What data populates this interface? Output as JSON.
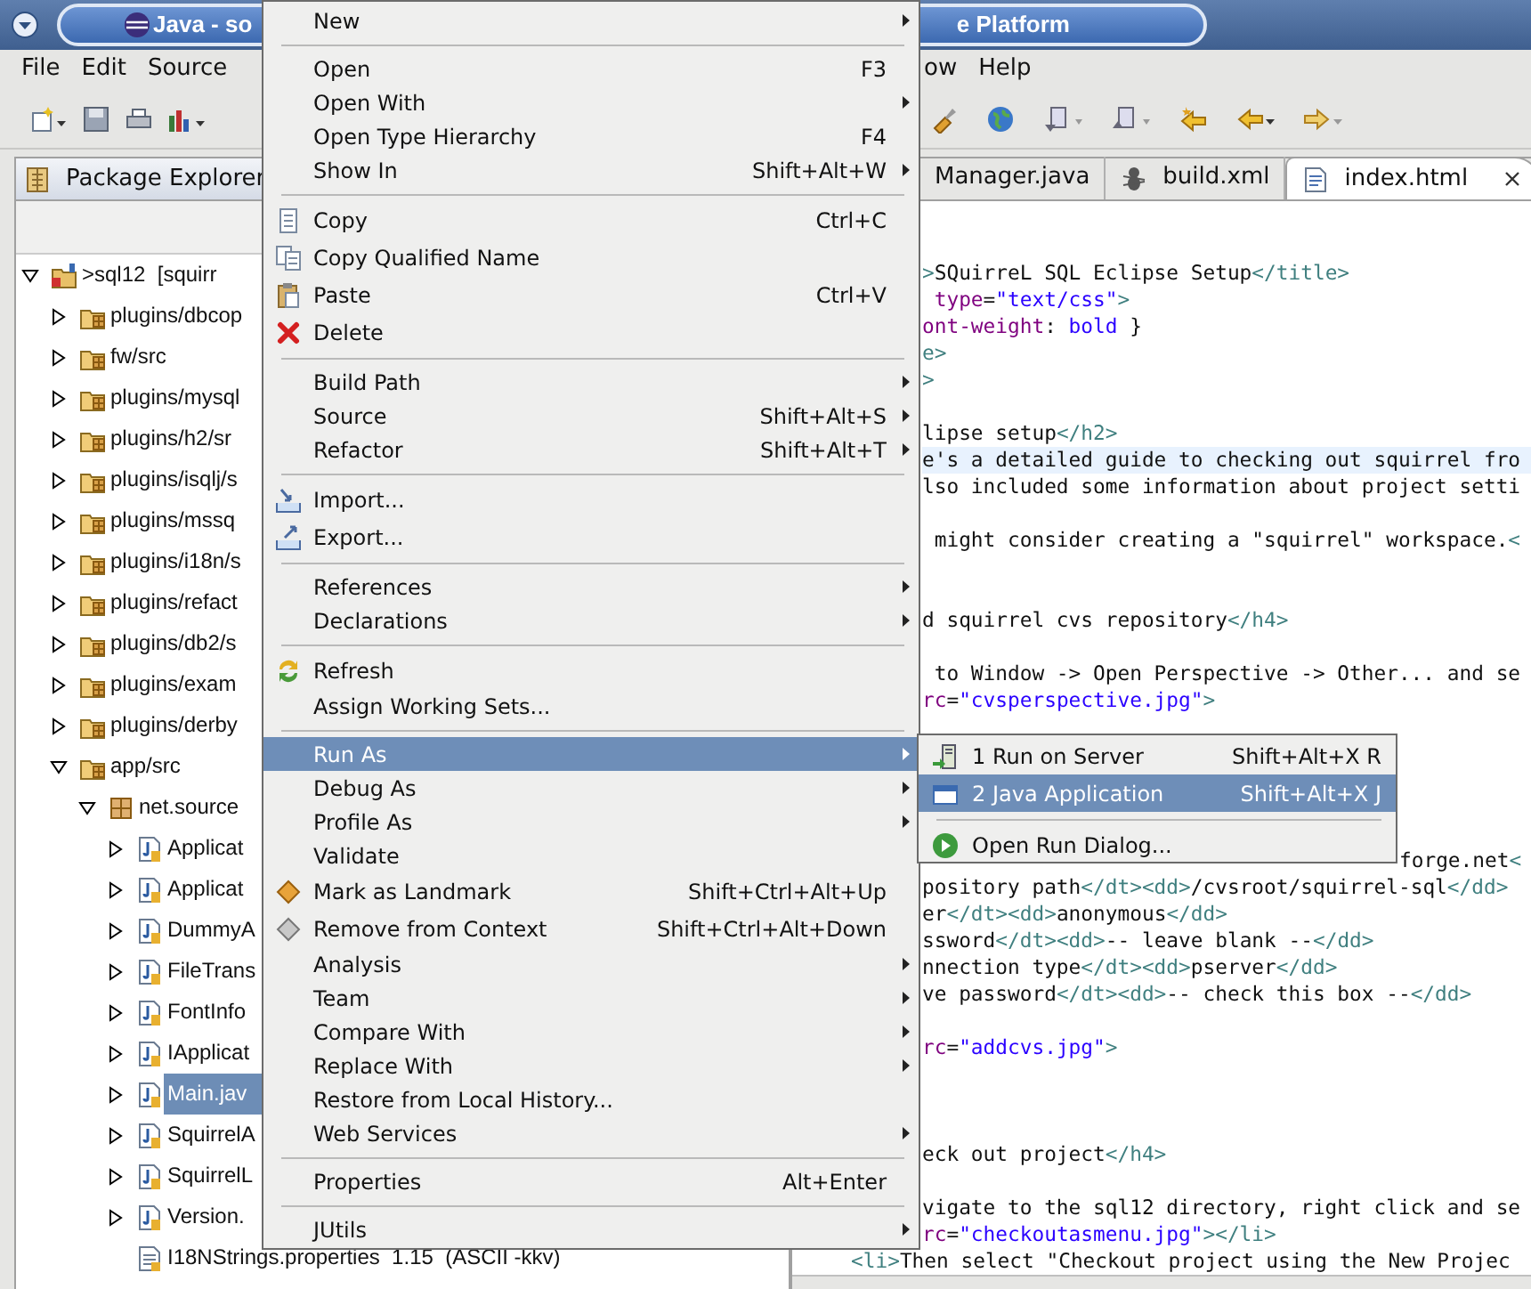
{
  "window": {
    "title_left": "Java - so",
    "title_right": "e Platform"
  },
  "menubar": [
    {
      "label": "File",
      "kind": "left"
    },
    {
      "label": "Edit",
      "kind": "left"
    },
    {
      "label": "Source",
      "kind": "left"
    },
    {
      "label": "ow",
      "kind": "right"
    },
    {
      "label": "Help",
      "kind": "right"
    }
  ],
  "package_explorer": {
    "tab_label": "Package Explorer",
    "items": [
      {
        "label": ">sql12  [squirr",
        "kind": "project",
        "expanded": true,
        "selected": false,
        "children": [
          {
            "label": "plugins/dbcop",
            "kind": "folder",
            "expanded": false,
            "selected": false
          },
          {
            "label": "fw/src",
            "kind": "folder",
            "expanded": false,
            "selected": false
          },
          {
            "label": "plugins/mysql",
            "kind": "folder",
            "expanded": false,
            "selected": false
          },
          {
            "label": "plugins/h2/sr",
            "kind": "folder",
            "expanded": false,
            "selected": false
          },
          {
            "label": "plugins/isqlj/s",
            "kind": "folder",
            "expanded": false,
            "selected": false
          },
          {
            "label": "plugins/mssq",
            "kind": "folder",
            "expanded": false,
            "selected": false
          },
          {
            "label": "plugins/i18n/s",
            "kind": "folder",
            "expanded": false,
            "selected": false
          },
          {
            "label": "plugins/refact",
            "kind": "folder",
            "expanded": false,
            "selected": false
          },
          {
            "label": "plugins/db2/s",
            "kind": "folder",
            "expanded": false,
            "selected": false
          },
          {
            "label": "plugins/exam",
            "kind": "folder",
            "expanded": false,
            "selected": false
          },
          {
            "label": "plugins/derby",
            "kind": "folder",
            "expanded": false,
            "selected": false
          },
          {
            "label": "app/src",
            "kind": "folder",
            "expanded": true,
            "selected": false,
            "children": [
              {
                "label": "net.source",
                "kind": "package",
                "expanded": true,
                "selected": false,
                "children": [
                  {
                    "label": "Applicat",
                    "kind": "java",
                    "expanded": false,
                    "selected": false
                  },
                  {
                    "label": "Applicat",
                    "kind": "java",
                    "expanded": false,
                    "selected": false
                  },
                  {
                    "label": "DummyA",
                    "kind": "java",
                    "expanded": false,
                    "selected": false
                  },
                  {
                    "label": "FileTrans",
                    "kind": "java",
                    "expanded": false,
                    "selected": false
                  },
                  {
                    "label": "FontInfo",
                    "kind": "java",
                    "expanded": false,
                    "selected": false
                  },
                  {
                    "label": "IApplicat",
                    "kind": "java",
                    "expanded": false,
                    "selected": false
                  },
                  {
                    "label": "Main.jav",
                    "kind": "java",
                    "expanded": false,
                    "selected": true
                  },
                  {
                    "label": "SquirrelA",
                    "kind": "java",
                    "expanded": false,
                    "selected": false
                  },
                  {
                    "label": "SquirrelL",
                    "kind": "java",
                    "expanded": false,
                    "selected": false
                  },
                  {
                    "label": "Version.",
                    "kind": "java",
                    "expanded": false,
                    "selected": false
                  },
                  {
                    "label": "I18NStrings.properties  1.15  (ASCII -kkv)",
                    "kind": "file",
                    "selected": false
                  }
                ]
              }
            ]
          }
        ]
      }
    ]
  },
  "editor": {
    "tabs": [
      {
        "label": "Manager.java",
        "kind": "partial",
        "selected": false,
        "closable": false
      },
      {
        "label": "build.xml",
        "kind": "ant",
        "selected": false,
        "closable": false
      },
      {
        "label": "index.html",
        "kind": "html",
        "selected": true,
        "closable": true
      }
    ],
    "lines": [
      {
        "kind": "cut",
        "current": false,
        "segments": [
          {
            "t": ">",
            "kind": "tag"
          },
          {
            "t": "SQuirreL SQL Eclipse Setup",
            "kind": "text"
          },
          {
            "t": "</title>",
            "kind": "tag"
          }
        ]
      },
      {
        "kind": "cut",
        "current": false,
        "segments": [
          {
            "t": " type",
            "kind": "attr"
          },
          {
            "t": "=",
            "kind": "text"
          },
          {
            "t": "\"text/css\"",
            "kind": "value"
          },
          {
            "t": ">",
            "kind": "tag"
          }
        ]
      },
      {
        "kind": "cut",
        "current": false,
        "segments": [
          {
            "t": "ont-weight",
            "kind": "attr"
          },
          {
            "t": ": ",
            "kind": "text"
          },
          {
            "t": "bold",
            "kind": "value"
          },
          {
            "t": " }",
            "kind": "text"
          }
        ]
      },
      {
        "kind": "cut",
        "current": false,
        "segments": [
          {
            "t": "e>",
            "kind": "tag"
          }
        ]
      },
      {
        "kind": "cut",
        "current": false,
        "segments": [
          {
            "t": ">",
            "kind": "tag"
          }
        ]
      },
      {
        "kind": "blank"
      },
      {
        "kind": "cut",
        "current": false,
        "segments": [
          {
            "t": "lipse setup",
            "kind": "text"
          },
          {
            "t": "</h2>",
            "kind": "tag"
          }
        ]
      },
      {
        "kind": "cut",
        "current": true,
        "segments": [
          {
            "t": "e's a detailed guide to checking out squirrel fro",
            "kind": "text"
          }
        ]
      },
      {
        "kind": "cut",
        "current": false,
        "segments": [
          {
            "t": "lso included some information about project setti",
            "kind": "text"
          }
        ]
      },
      {
        "kind": "blank"
      },
      {
        "kind": "cut",
        "current": false,
        "segments": [
          {
            "t": " might consider creating a \"squirrel\" workspace.",
            "kind": "text"
          },
          {
            "t": "<",
            "kind": "tag"
          }
        ]
      },
      {
        "kind": "blank"
      },
      {
        "kind": "blank"
      },
      {
        "kind": "cut",
        "current": false,
        "segments": [
          {
            "t": "d squirrel cvs repository",
            "kind": "text"
          },
          {
            "t": "</h4>",
            "kind": "tag"
          }
        ]
      },
      {
        "kind": "blank"
      },
      {
        "kind": "cut",
        "current": false,
        "segments": [
          {
            "t": " to Window -> Open Perspective -> Other... and se",
            "kind": "text"
          }
        ]
      },
      {
        "kind": "cut",
        "current": false,
        "segments": [
          {
            "t": "rc",
            "kind": "attr"
          },
          {
            "t": "=",
            "kind": "text"
          },
          {
            "t": "\"cvsperspective.jpg\"",
            "kind": "value"
          },
          {
            "t": ">",
            "kind": "tag"
          }
        ]
      },
      {
        "kind": "blank"
      },
      {
        "kind": "blank"
      },
      {
        "kind": "blank"
      },
      {
        "kind": "blank"
      },
      {
        "kind": "blank"
      },
      {
        "kind": "behind-submenu",
        "current": false,
        "segments": [
          {
            "t": "forge.net",
            "kind": "text"
          },
          {
            "t": "<",
            "kind": "tag"
          }
        ]
      },
      {
        "kind": "cut",
        "current": false,
        "segments": [
          {
            "t": "pository path",
            "kind": "text"
          },
          {
            "t": "</dt><dd>",
            "kind": "tag"
          },
          {
            "t": "/cvsroot/squirrel-sql",
            "kind": "text"
          },
          {
            "t": "</dd>",
            "kind": "tag"
          }
        ]
      },
      {
        "kind": "cut",
        "current": false,
        "segments": [
          {
            "t": "er",
            "kind": "text"
          },
          {
            "t": "</dt><dd>",
            "kind": "tag"
          },
          {
            "t": "anonymous",
            "kind": "text"
          },
          {
            "t": "</dd>",
            "kind": "tag"
          }
        ]
      },
      {
        "kind": "cut",
        "current": false,
        "segments": [
          {
            "t": "ssword",
            "kind": "text"
          },
          {
            "t": "</dt><dd>",
            "kind": "tag"
          },
          {
            "t": "-- leave blank --",
            "kind": "text"
          },
          {
            "t": "</dd>",
            "kind": "tag"
          }
        ]
      },
      {
        "kind": "cut",
        "current": false,
        "segments": [
          {
            "t": "nnection type",
            "kind": "text"
          },
          {
            "t": "</dt><dd>",
            "kind": "tag"
          },
          {
            "t": "pserver",
            "kind": "text"
          },
          {
            "t": "</dd>",
            "kind": "tag"
          }
        ]
      },
      {
        "kind": "cut",
        "current": false,
        "segments": [
          {
            "t": "ve password",
            "kind": "text"
          },
          {
            "t": "</dt><dd>",
            "kind": "tag"
          },
          {
            "t": "-- check this box --",
            "kind": "text"
          },
          {
            "t": "</dd>",
            "kind": "tag"
          }
        ]
      },
      {
        "kind": "blank"
      },
      {
        "kind": "cut",
        "current": false,
        "segments": [
          {
            "t": "rc",
            "kind": "attr"
          },
          {
            "t": "=",
            "kind": "text"
          },
          {
            "t": "\"addcvs.jpg\"",
            "kind": "value"
          },
          {
            "t": ">",
            "kind": "tag"
          }
        ]
      },
      {
        "kind": "blank"
      },
      {
        "kind": "blank"
      },
      {
        "kind": "blank"
      },
      {
        "kind": "cut",
        "current": false,
        "segments": [
          {
            "t": "eck out project",
            "kind": "text"
          },
          {
            "t": "</h4>",
            "kind": "tag"
          }
        ]
      },
      {
        "kind": "blank"
      },
      {
        "kind": "cut",
        "current": false,
        "segments": [
          {
            "t": "vigate to the sql12 directory, right click and se",
            "kind": "text"
          }
        ]
      },
      {
        "kind": "cut",
        "current": false,
        "segments": [
          {
            "t": "rc",
            "kind": "attr"
          },
          {
            "t": "=",
            "kind": "text"
          },
          {
            "t": "\"checkoutasmenu.jpg\"",
            "kind": "value"
          },
          {
            "t": "></li>",
            "kind": "tag"
          }
        ]
      },
      {
        "kind": "full",
        "current": false,
        "segments": [
          {
            "t": "<li>",
            "kind": "tag"
          },
          {
            "t": "Then select \"Checkout project using the New Projec",
            "kind": "text"
          }
        ]
      }
    ]
  },
  "context_menu": {
    "items": [
      {
        "kind": "item",
        "label": "New",
        "submenu": true,
        "selected": false
      },
      {
        "kind": "separator"
      },
      {
        "kind": "item",
        "label": "Open",
        "shortcut": "F3",
        "submenu": false,
        "selected": false
      },
      {
        "kind": "item",
        "label": "Open With",
        "submenu": true,
        "selected": false
      },
      {
        "kind": "item",
        "label": "Open Type Hierarchy",
        "shortcut": "F4",
        "submenu": false,
        "selected": false
      },
      {
        "kind": "item",
        "label": "Show In",
        "shortcut": "Shift+Alt+W",
        "submenu": true,
        "selected": false
      },
      {
        "kind": "separator"
      },
      {
        "kind": "item",
        "label": "Copy",
        "shortcut": "Ctrl+C",
        "submenu": false,
        "selected": false
      },
      {
        "kind": "item",
        "label": "Copy Qualified Name",
        "submenu": false,
        "selected": false
      },
      {
        "kind": "item",
        "label": "Paste",
        "shortcut": "Ctrl+V",
        "submenu": false,
        "selected": false
      },
      {
        "kind": "item",
        "label": "Delete",
        "submenu": false,
        "selected": false
      },
      {
        "kind": "separator"
      },
      {
        "kind": "item",
        "label": "Build Path",
        "submenu": true,
        "selected": false
      },
      {
        "kind": "item",
        "label": "Source",
        "shortcut": "Shift+Alt+S",
        "submenu": true,
        "selected": false
      },
      {
        "kind": "item",
        "label": "Refactor",
        "shortcut": "Shift+Alt+T",
        "submenu": true,
        "selected": false
      },
      {
        "kind": "separator"
      },
      {
        "kind": "item",
        "label": "Import...",
        "submenu": false,
        "selected": false
      },
      {
        "kind": "item",
        "label": "Export...",
        "submenu": false,
        "selected": false
      },
      {
        "kind": "separator"
      },
      {
        "kind": "item",
        "label": "References",
        "submenu": true,
        "selected": false
      },
      {
        "kind": "item",
        "label": "Declarations",
        "submenu": true,
        "selected": false
      },
      {
        "kind": "separator"
      },
      {
        "kind": "item",
        "label": "Refresh",
        "submenu": false,
        "selected": false
      },
      {
        "kind": "item",
        "label": "Assign Working Sets...",
        "submenu": false,
        "selected": false
      },
      {
        "kind": "separator"
      },
      {
        "kind": "item",
        "label": "Run As",
        "submenu": true,
        "selected": true
      },
      {
        "kind": "item",
        "label": "Debug As",
        "submenu": true,
        "selected": false
      },
      {
        "kind": "item",
        "label": "Profile As",
        "submenu": true,
        "selected": false
      },
      {
        "kind": "item",
        "label": "Validate",
        "submenu": false,
        "selected": false
      },
      {
        "kind": "item",
        "label": "Mark as Landmark",
        "shortcut": "Shift+Ctrl+Alt+Up",
        "submenu": false,
        "selected": false
      },
      {
        "kind": "item",
        "label": "Remove from Context",
        "shortcut": "Shift+Ctrl+Alt+Down",
        "submenu": false,
        "selected": false
      },
      {
        "kind": "item",
        "label": "Analysis",
        "submenu": true,
        "selected": false
      },
      {
        "kind": "item",
        "label": "Team",
        "submenu": true,
        "selected": false
      },
      {
        "kind": "item",
        "label": "Compare With",
        "submenu": true,
        "selected": false
      },
      {
        "kind": "item",
        "label": "Replace With",
        "submenu": true,
        "selected": false
      },
      {
        "kind": "item",
        "label": "Restore from Local History...",
        "submenu": false,
        "selected": false
      },
      {
        "kind": "item",
        "label": "Web Services",
        "submenu": true,
        "selected": false
      },
      {
        "kind": "separator"
      },
      {
        "kind": "item",
        "label": "Properties",
        "shortcut": "Alt+Enter",
        "submenu": false,
        "selected": false
      },
      {
        "kind": "separator"
      },
      {
        "kind": "item",
        "label": "JUtils",
        "submenu": true,
        "selected": false
      }
    ]
  },
  "submenu": {
    "items": [
      {
        "kind": "item",
        "label": "1 Run on Server",
        "shortcut": "Shift+Alt+X R",
        "selected": false
      },
      {
        "kind": "item",
        "label": "2 Java Application",
        "shortcut": "Shift+Alt+X J",
        "selected": true
      },
      {
        "kind": "separator"
      },
      {
        "kind": "item",
        "label": "Open Run Dialog...",
        "selected": false
      }
    ]
  }
}
